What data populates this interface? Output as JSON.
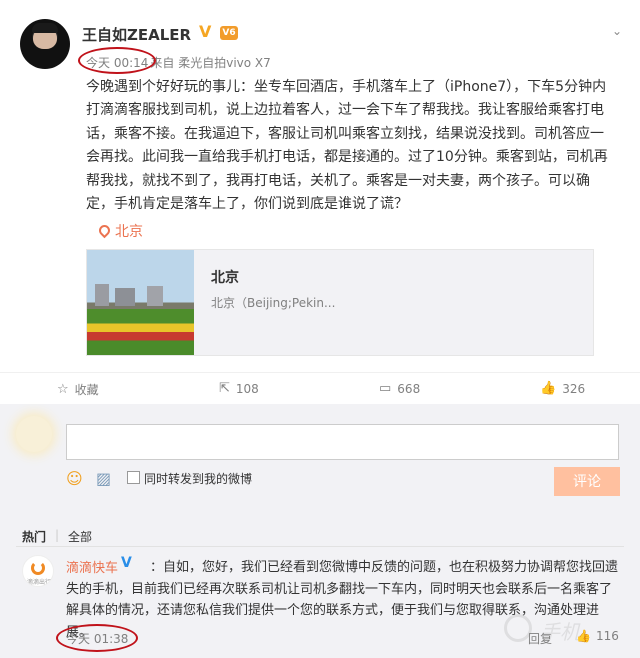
{
  "post": {
    "author": "王自如ZEALER",
    "time": "今天 00:14",
    "source": "来自 柔光自拍vivo X7",
    "text": "今晚遇到个好好玩的事儿：坐专车回酒店，手机落车上了（iPhone7），下车5分钟内打滴滴客服找到司机，说上边拉着客人，过一会下车了帮我找。我让客服给乘客打电话，乘客不接。在我逼迫下，客服让司机叫乘客立刻找，结果说没找到。司机答应一会再找。此间我一直给我手机打电话，都是接通的。过了10分钟。乘客到站，司机再帮我找，就找不到了，我再打电话，关机了。乘客是一对夫妻，两个孩子。可以确定，手机肯定是落车上了，你们说到底是谁说了谎？",
    "location": "北京",
    "card": {
      "title": "北京",
      "desc": "北京（Beijing;Pekin..."
    },
    "icons": {
      "verified": "verified-v-icon",
      "vip": "vip-badge-icon",
      "chevron": "chevron-down-icon"
    }
  },
  "actions": {
    "favorite": {
      "icon": "star-icon",
      "label": "收藏"
    },
    "repost": {
      "icon": "repost-icon",
      "label": "108"
    },
    "comment": {
      "icon": "comment-icon",
      "label": "668"
    },
    "like": {
      "icon": "thumbs-up-icon",
      "label": "326"
    }
  },
  "compose": {
    "input_value": "",
    "repost_checkbox_label": "同时转发到我的微博",
    "submit_label": "评论",
    "tools": [
      "emoji-icon",
      "image-icon"
    ]
  },
  "comments": {
    "tabs": [
      "热门",
      "|",
      "全部"
    ],
    "items": [
      {
        "author": "滴滴快车",
        "text": "：自如，您好，我们已经看到您微博中反馈的问题，也在积极努力协调帮您找回遗失的手机，目前我们已经再次联系司机让司机多翻找一下车内，同时明天也会联系后一名乘客了解具体的情况，还请您私信我们提供一个您的联系方式，便于我们与您取得联系，沟通处理进展。",
        "time": "今天 01:38",
        "reply_label": "回复",
        "likes": "116"
      }
    ]
  },
  "colors": {
    "accent": "#eb7350",
    "annotation": "#c0121a",
    "submit": "#ffc09f",
    "background": "#f2f2f5"
  }
}
